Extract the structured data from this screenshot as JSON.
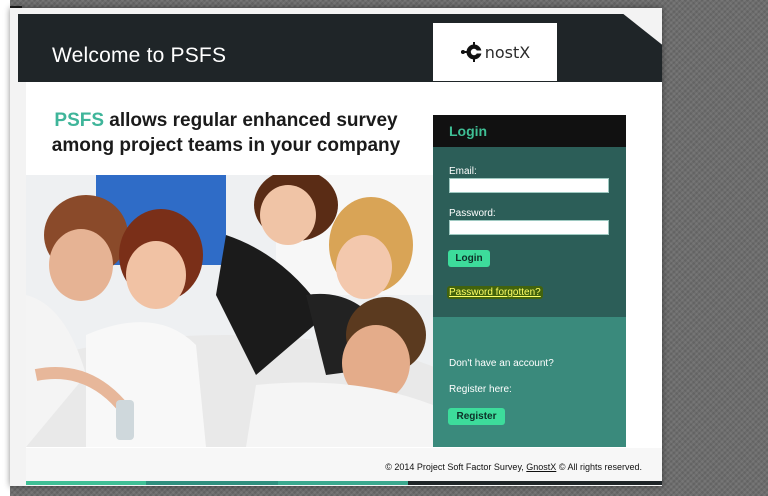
{
  "header": {
    "title": "Welcome to PSFS",
    "logo_text": "nostX",
    "logo_name": "GnostX"
  },
  "intro": {
    "accent": "PSFS",
    "line1_rest": "allows regular enhanced survey",
    "line2": "among project teams in your company"
  },
  "login": {
    "title": "Login",
    "email_label": "Email:",
    "email_value": "",
    "password_label": "Password:",
    "password_value": "",
    "login_button": "Login",
    "forgot_link": "Password forgotten?"
  },
  "register": {
    "prompt": "Don't have an account?",
    "register_here": "Register here:",
    "register_button": "Register"
  },
  "footer": {
    "prefix": "© 2014 Project Soft Factor Survey,",
    "link": "GnostX",
    "suffix": "© All rights reserved."
  },
  "colors": {
    "accent": "#3fb59a",
    "header_bg": "#1f2528",
    "panel_dark": "#2c5e58",
    "panel_light": "#3a8a7c",
    "button": "#3ddc9b",
    "link_highlight": "#ffff66"
  },
  "icons": {
    "logo": "gnostx-logo-icon"
  }
}
